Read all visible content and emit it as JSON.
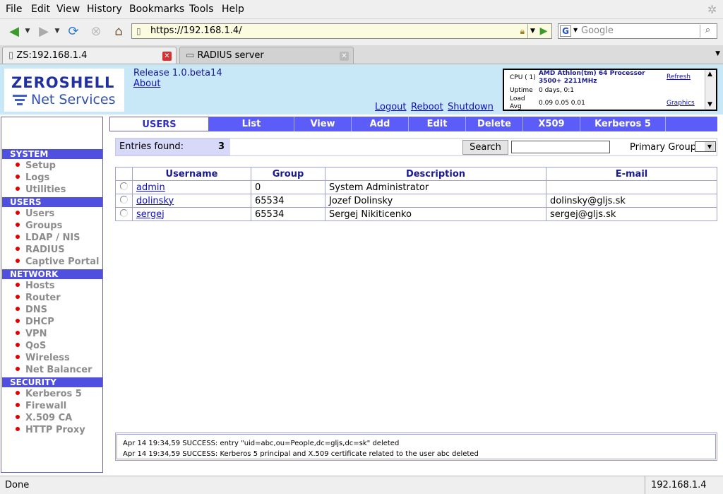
{
  "menu": [
    "File",
    "Edit",
    "View",
    "History",
    "Bookmarks",
    "Tools",
    "Help"
  ],
  "url": "https://192.168.1.4/",
  "search_placeholder": "Google",
  "tabs": [
    {
      "label": "ZS:192.168.1.4"
    },
    {
      "label": "RADIUS server"
    }
  ],
  "header": {
    "logo_top": "ZEROSHELL",
    "logo_bottom": "Net Services",
    "release": "Release 1.0.beta14",
    "about": "About",
    "logout": "Logout",
    "reboot": "Reboot",
    "shutdown": "Shutdown"
  },
  "sysinfo": {
    "cpu_label": "CPU ( 1)",
    "cpu_value": "AMD Athlon(tm) 64 Processor 3500+ 2211MHz",
    "refresh": "Refresh",
    "uptime_label": "Uptime",
    "uptime_value": "0 days, 0:1",
    "load_label": "Load Avg",
    "load_value": "0.09 0.05 0.01",
    "graphics": "Graphics"
  },
  "sidebar": [
    {
      "section": "SYSTEM",
      "items": [
        "Setup",
        "Logs",
        "Utilities"
      ]
    },
    {
      "section": "USERS",
      "items": [
        "Users",
        "Groups",
        "LDAP / NIS",
        "RADIUS",
        "Captive Portal"
      ]
    },
    {
      "section": "NETWORK",
      "items": [
        "Hosts",
        "Router",
        "DNS",
        "DHCP",
        "VPN",
        "QoS",
        "Wireless",
        "Net Balancer"
      ]
    },
    {
      "section": "SECURITY",
      "items": [
        "Kerberos 5",
        "Firewall",
        "X.509 CA",
        "HTTP Proxy"
      ]
    }
  ],
  "toptabs": [
    "USERS",
    "List",
    "View",
    "Add",
    "Edit",
    "Delete",
    "X509",
    "Kerberos 5"
  ],
  "filter": {
    "entries_label": "Entries found:",
    "entries_count": "3",
    "search_button": "Search",
    "primary_group_label": "Primary Group"
  },
  "table": {
    "headers": [
      "Username",
      "Group",
      "Description",
      "E-mail"
    ],
    "rows": [
      {
        "username": "admin",
        "group": "0",
        "description": "System Administrator",
        "email": ""
      },
      {
        "username": "dolinsky",
        "group": "65534",
        "description": "Jozef Dolinsky",
        "email": "dolinsky@gljs.sk"
      },
      {
        "username": "sergej",
        "group": "65534",
        "description": "Sergej Nikiticenko",
        "email": "sergej@gljs.sk"
      }
    ]
  },
  "log": [
    "Apr 14 19:34,59 SUCCESS: entry \"uid=abc,ou=People,dc=gljs,dc=sk\" deleted",
    "Apr 14 19:34,59 SUCCESS: Kerberos 5 principal and X.509 certificate related to the user abc deleted"
  ],
  "status": {
    "left": "Done",
    "right": "192.168.1.4"
  }
}
